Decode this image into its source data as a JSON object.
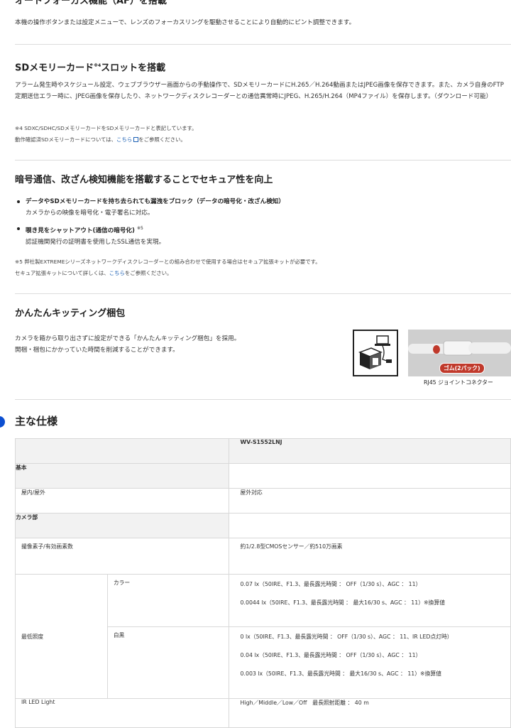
{
  "af": {
    "heading": "オートフォーカス機能（AF）を搭載",
    "text": "本機の操作ボタンまたは設定メニューで、レンズのフォーカスリングを駆動させることにより自動的にピント調整できます。"
  },
  "sd": {
    "heading": "SDメモリーカード",
    "heading_sup": "※4",
    "heading_tail": "スロットを搭載",
    "text1": "アラーム発生時やスケジュール設定、ウェブブラウザー画面からの手動操作で、SDメモリーカードにH.265／H.264動画またはJPEG画像を保存できます。また、カメラ自身のFTP定期送信エラー時に、JPEG画像を保存したり、ネットワークディスクレコーダーとの通信異常時にJPEG、H.265/H.264（MP4ファイル）を保存します。（ダウンロード可能）",
    "note1": "※4 SDXC/SDHC/SDメモリーカードをSDメモリーカードと表記しています。",
    "note2_pre": "動作確認済SDメモリーカードについては、",
    "note2_link": "こちら",
    "note2_post": "をご参照ください。"
  },
  "secure": {
    "heading": "暗号通信、改ざん検知機能を搭載することでセキュア性を向上",
    "bullet1_title": "データやSDメモリーカードを持ち去られても漏洩をブロック（データの暗号化・改ざん検知）",
    "bullet1_text": "カメラからの映像を暗号化・電子署名に対応。",
    "bullet2_title": "覗き見をシャットアウト(通信の暗号化)",
    "bullet2_sup": "※5",
    "bullet2_text": "認証機関発行の証明書を使用したSSL通信を実現。",
    "note1": "※5 弊社製EXTREMEシリーズネットワークディスクレコーダーとの組み合わせで使用する場合はセキュア拡張キットが必要です。",
    "note2_pre": "セキュア拡張キットについて詳しくは、",
    "note2_link": "こちら",
    "note2_post": "をご参照ください。"
  },
  "kit": {
    "heading": "かんたんキッティング梱包",
    "text1": "カメラを箱から取り出さずに設定ができる「かんたんキッティング梱包」を採用。",
    "text2": "開梱・梱包にかかっていた時間を削減することができます。",
    "photo_badge": "ゴム(2パック)",
    "photo_caption": "RJ45 ジョイントコネクター"
  },
  "spec": {
    "heading": "主な仕様",
    "model": "WV-S1552LNJ",
    "cat_basic": "基本",
    "indoor_label": "屋内/屋外",
    "indoor_value": "屋外対応",
    "cat_camera": "カメラ部",
    "sensor_label": "撮像素子/有効画素数",
    "sensor_value": "約1/2.8型CMOSセンサー／約510万画素",
    "illum_label": "最低照度",
    "color_label": "カラー",
    "color_v1": "0.07 lx（50IRE、F1.3、最長露光時間 ： OFF（1/30 s）、AGC ： 11）",
    "color_v2": "0.0044 lx（50IRE、F1.3、最長露光時間 ： 最大16/30 s、AGC ： 11）※換算値",
    "bw_label": "白黒",
    "bw_v1": "0 lx（50IRE、F1.3、最長露光時間 ： OFF（1/30 s）、AGC ： 11、IR LED点灯時）",
    "bw_v2": "0.04 lx（50IRE、F1.3、最長露光時間 ： OFF（1/30 s）、AGC ： 11）",
    "bw_v3": "0.003 lx（50IRE、F1.3、最長露光時間 ： 最大16/30 s、AGC ： 11）※換算値",
    "ir_label": "IR LED Light",
    "ir_value": "High／Middle／Low／Off　最長照射距離 ： 40 m"
  }
}
